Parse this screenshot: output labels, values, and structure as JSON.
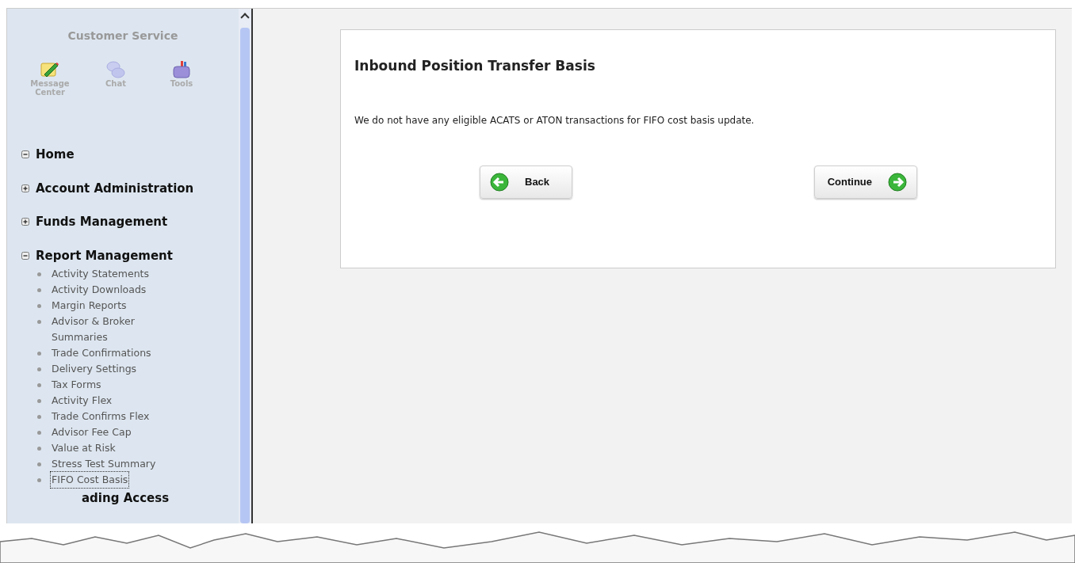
{
  "sidebar": {
    "title": "Customer Service",
    "shortcuts": [
      {
        "kind": "message",
        "label": "Message Center"
      },
      {
        "kind": "chat",
        "label": "Chat"
      },
      {
        "kind": "tools",
        "label": "Tools"
      }
    ],
    "sections": [
      {
        "label": "Home",
        "expanded": true
      },
      {
        "label": "Account Administration",
        "expanded": false
      },
      {
        "label": "Funds Management",
        "expanded": false
      },
      {
        "label": "Report Management",
        "expanded": true,
        "children": [
          {
            "label": "Activity Statements",
            "selected": false
          },
          {
            "label": "Activity Downloads",
            "selected": false
          },
          {
            "label": "Margin Reports",
            "selected": false
          },
          {
            "label": "Advisor & Broker Summaries",
            "selected": false
          },
          {
            "label": "Trade Confirmations",
            "selected": false
          },
          {
            "label": "Delivery Settings",
            "selected": false
          },
          {
            "label": "Tax Forms",
            "selected": false
          },
          {
            "label": "Activity Flex",
            "selected": false
          },
          {
            "label": "Trade Confirms Flex",
            "selected": false
          },
          {
            "label": "Advisor Fee Cap",
            "selected": false
          },
          {
            "label": "Value at Risk",
            "selected": false
          },
          {
            "label": "Stress Test Summary",
            "selected": false
          },
          {
            "label": "FIFO Cost Basis",
            "selected": true
          }
        ]
      }
    ],
    "cut_section": "ading Access"
  },
  "panel": {
    "title": "Inbound Position Transfer Basis",
    "message": "We do not have any eligible ACATS or ATON transactions for FIFO cost basis update.",
    "buttons": [
      {
        "kind": "back",
        "label": "Back"
      },
      {
        "kind": "forward",
        "label": "Continue"
      }
    ]
  }
}
